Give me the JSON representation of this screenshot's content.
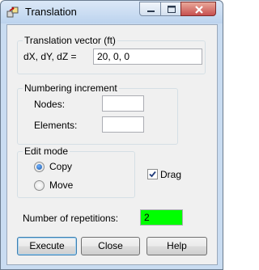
{
  "window": {
    "title": "Translation",
    "title_icon": "translation-app-icon"
  },
  "translation_vector": {
    "group_label": "Translation vector (ft)",
    "field_label": "dX, dY, dZ  =",
    "value": "20, 0, 0"
  },
  "numbering_increment": {
    "group_label": "Numbering increment",
    "nodes_label": "Nodes:",
    "nodes_value": "",
    "elements_label": "Elements:",
    "elements_value": ""
  },
  "edit_mode": {
    "group_label": "Edit mode",
    "copy_label": "Copy",
    "move_label": "Move",
    "selected": "Copy"
  },
  "drag": {
    "label": "Drag",
    "checked": true
  },
  "repetitions": {
    "label": "Number of repetitions:",
    "value": "2",
    "highlight_color": "#00ff00"
  },
  "buttons": {
    "execute": "Execute",
    "close": "Close",
    "help": "Help"
  }
}
